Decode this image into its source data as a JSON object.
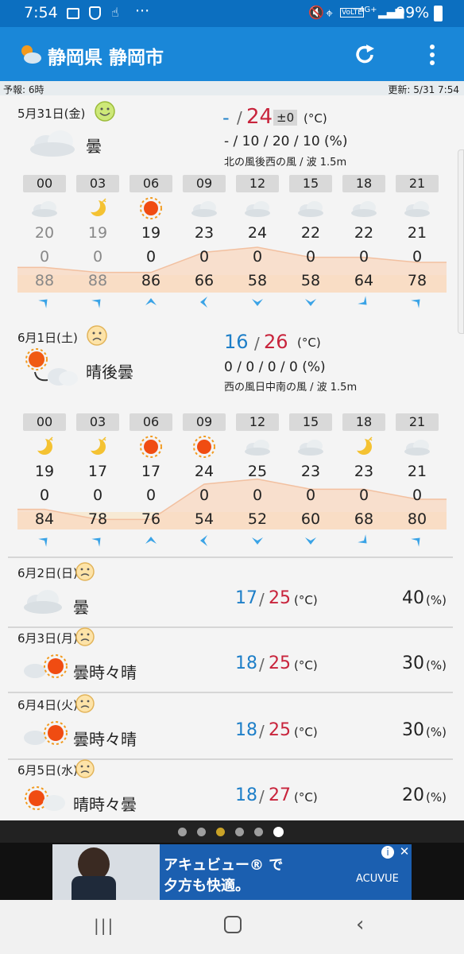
{
  "status": {
    "time": "7:54",
    "dots": "···",
    "network": "4G+",
    "battery": "99%"
  },
  "appbar": {
    "title": "静岡県 静岡市"
  },
  "info": {
    "forecast": "予報: 6時",
    "updated": "更新: 5/31 7:54"
  },
  "day1": {
    "date": "5月31日(金)",
    "weather": "曇",
    "min": "-",
    "sep": "/",
    "max": "24",
    "diff": "±0",
    "unit": "(°C)",
    "rain": "- / 10 / 20 / 10 (%)",
    "wind": "北の風後西の風 / 波 1.5m",
    "hours": [
      "00",
      "03",
      "06",
      "09",
      "12",
      "15",
      "18",
      "21"
    ],
    "icons": [
      "cloud-icon",
      "moon-icon",
      "sun-icon",
      "cloud-icon",
      "cloud-icon",
      "cloud-icon",
      "cloud-icon",
      "cloud-icon"
    ],
    "temps": [
      "20",
      "19",
      "19",
      "23",
      "24",
      "22",
      "22",
      "21"
    ],
    "precip": [
      "0",
      "0",
      "0",
      "0",
      "0",
      "0",
      "0",
      "0"
    ],
    "humidity": [
      "88",
      "88",
      "86",
      "66",
      "58",
      "58",
      "64",
      "78"
    ],
    "wind_dirs": [
      "north-arrow",
      "north-arrow",
      "northwest-arrow",
      "west-arrow",
      "south-arrow",
      "south-arrow",
      "southwest-arrow",
      "north-arrow"
    ]
  },
  "day2": {
    "date": "6月1日(土)",
    "weather": "晴後曇",
    "min": "16",
    "sep": "/",
    "max": "26",
    "unit": "(°C)",
    "rain": "0 / 0 / 0 / 0 (%)",
    "wind": "西の風日中南の風 / 波 1.5m",
    "hours": [
      "00",
      "03",
      "06",
      "09",
      "12",
      "15",
      "18",
      "21"
    ],
    "icons": [
      "moon-icon",
      "moon-icon",
      "sun-icon",
      "sun-icon",
      "cloud-icon",
      "cloud-icon",
      "moon-icon",
      "cloud-icon"
    ],
    "temps": [
      "19",
      "17",
      "17",
      "24",
      "25",
      "23",
      "23",
      "21"
    ],
    "precip": [
      "0",
      "0",
      "0",
      "0",
      "0",
      "0",
      "0",
      "0"
    ],
    "humidity": [
      "84",
      "78",
      "76",
      "54",
      "52",
      "60",
      "68",
      "80"
    ]
  },
  "week": [
    {
      "date": "6月2日(日)",
      "weather": "曇",
      "min": "17",
      "sep": "/",
      "max": "25",
      "unit": "(°C)",
      "pop": "40",
      "pop_unit": "(%)"
    },
    {
      "date": "6月3日(月)",
      "weather": "曇時々晴",
      "min": "18",
      "sep": "/",
      "max": "25",
      "unit": "(°C)",
      "pop": "30",
      "pop_unit": "(%)"
    },
    {
      "date": "6月4日(火)",
      "weather": "曇時々晴",
      "min": "18",
      "sep": "/",
      "max": "25",
      "unit": "(°C)",
      "pop": "30",
      "pop_unit": "(%)"
    },
    {
      "date": "6月5日(水)",
      "weather": "晴時々曇",
      "min": "18",
      "sep": "/",
      "max": "27",
      "unit": "(°C)",
      "pop": "20",
      "pop_unit": "(%)"
    }
  ],
  "pager": {
    "count": 6,
    "active": 5,
    "highlight": 2
  },
  "ad": {
    "line1": "アキュビュー® で",
    "line2": "夕方も快適。",
    "brand": "ACUVUE"
  },
  "colors": {
    "statusbar": "#0c6fc0",
    "appbar": "#1a87d8",
    "min_temp": "#1e7fc8",
    "max_temp": "#c8243c",
    "arrow": "#3aa3e6"
  }
}
